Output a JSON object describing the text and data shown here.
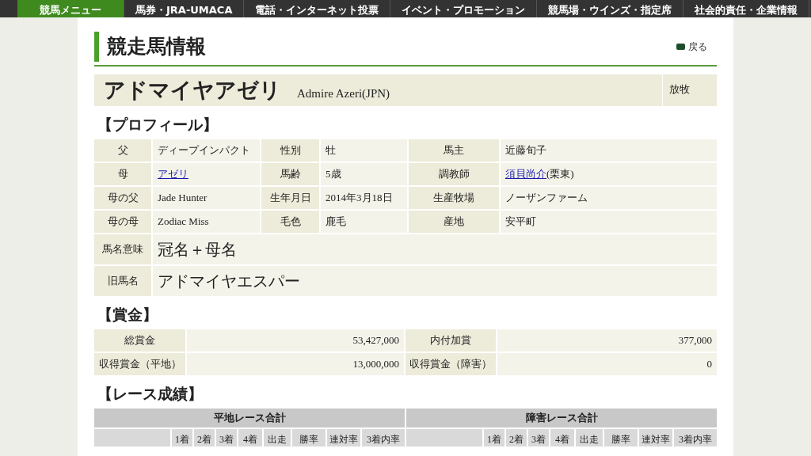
{
  "nav": [
    {
      "label": "競馬メニュー",
      "selected": true
    },
    {
      "label": "馬券・JRA-UMACA",
      "selected": false
    },
    {
      "label": "電話・インターネット投票",
      "selected": false
    },
    {
      "label": "イベント・プロモーション",
      "selected": false
    },
    {
      "label": "競馬場・ウインズ・指定席",
      "selected": false
    },
    {
      "label": "社会的責任・企業情報",
      "selected": false
    }
  ],
  "page_title": "競走馬情報",
  "back_link": "戻る",
  "horse": {
    "name_ja": "アドマイヤアゼリ",
    "name_en": "Admire Azeri(JPN)",
    "status": "放牧"
  },
  "profile": {
    "heading": "【プロフィール】",
    "rows": [
      [
        {
          "label": "父",
          "value": "ディープインパクト",
          "link": false
        },
        {
          "label": "性別",
          "value": "牡",
          "link": false
        },
        {
          "label": "馬主",
          "value": "近藤旬子",
          "link": false
        }
      ],
      [
        {
          "label": "母",
          "value": "アゼリ",
          "link": true
        },
        {
          "label": "馬齢",
          "value": "5歳",
          "link": false
        },
        {
          "label": "調教師",
          "value": "須貝尚介",
          "link": true,
          "suffix": "(栗東)"
        }
      ],
      [
        {
          "label": "母の父",
          "value": "Jade Hunter",
          "link": false
        },
        {
          "label": "生年月日",
          "value": "2014年3月18日",
          "link": false
        },
        {
          "label": "生産牧場",
          "value": "ノーザンファーム",
          "link": false
        }
      ],
      [
        {
          "label": "母の母",
          "value": "Zodiac Miss",
          "link": false
        },
        {
          "label": "毛色",
          "value": "鹿毛",
          "link": false
        },
        {
          "label": "産地",
          "value": "安平町",
          "link": false
        }
      ]
    ],
    "wide_rows": [
      {
        "label": "馬名意味",
        "value": "冠名＋母名"
      },
      {
        "label": "旧馬名",
        "value": "アドマイヤエスパー"
      }
    ]
  },
  "prize": {
    "heading": "【賞金】",
    "rows": [
      [
        {
          "label": "総賞金",
          "value": "53,427,000"
        },
        {
          "label": "内付加賞",
          "value": "377,000"
        }
      ],
      [
        {
          "label": "収得賞金（平地）",
          "value": "13,000,000"
        },
        {
          "label": "収得賞金（障害）",
          "value": "0"
        }
      ]
    ]
  },
  "race_results": {
    "heading": "【レース成績】",
    "groups": [
      {
        "title": "平地レース合計",
        "columns": [
          "1着",
          "2着",
          "3着",
          "4着",
          "出走",
          "勝率",
          "連対率",
          "3着内率"
        ]
      },
      {
        "title": "障害レース合計",
        "columns": [
          "1着",
          "2着",
          "3着",
          "4着",
          "出走",
          "勝率",
          "連対率",
          "3着内率"
        ]
      }
    ]
  }
}
